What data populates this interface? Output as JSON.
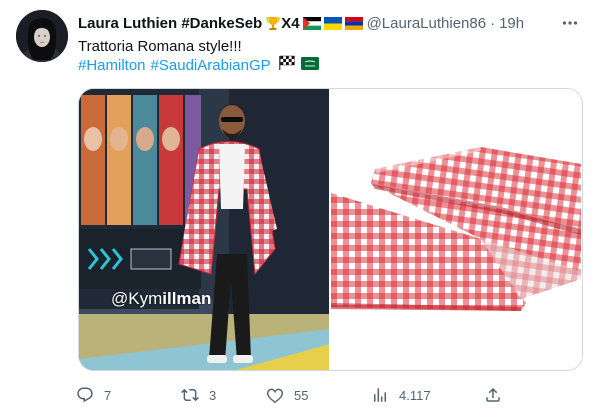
{
  "tweet": {
    "display_name": "Laura Luthien #DankeSeb",
    "badge_text": "X4",
    "handle": "@LauraLuthien86",
    "separator": "·",
    "time": "19h",
    "text": "Trattoria Romana style!!!",
    "hashtags": [
      "#Hamilton",
      "#SaudiArabianGP"
    ],
    "watermark_prefix": "@Kym",
    "watermark_bold": "illman"
  },
  "actions": {
    "replies": "7",
    "retweets": "3",
    "likes": "55",
    "views": "4.117"
  },
  "icons": {
    "badges": [
      "trophy-icon",
      "palestine-flag-icon",
      "ukraine-flag-icon",
      "armenia-flag-icon"
    ],
    "tag_flags": [
      "checkered-flag-icon",
      "saudi-flag-icon"
    ],
    "actions": [
      "reply-icon",
      "retweet-icon",
      "like-icon",
      "views-icon",
      "share-icon"
    ]
  },
  "colors": {
    "link": "#1d9bf0",
    "secondary_text": "#536471",
    "gingham_red": "#d9262f"
  }
}
